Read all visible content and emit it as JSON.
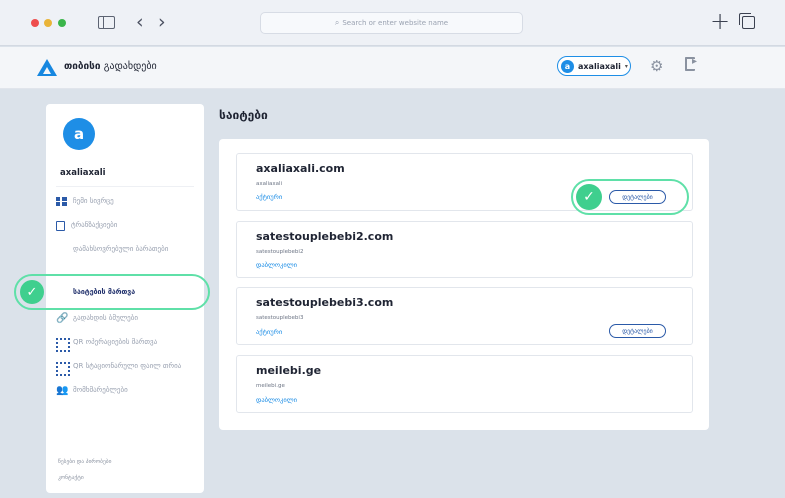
{
  "browser": {
    "address_placeholder": "Search or enter website name",
    "back_glyph": "‹",
    "forward_glyph": "›",
    "new_tab_glyph": "+"
  },
  "header": {
    "brand_bold": "თიბისი",
    "brand_rest": "გადახდები",
    "user_initial": "a",
    "username": "axaliaxali",
    "caret": "▾",
    "gear_glyph": "⚙"
  },
  "sidebar": {
    "avatar_initial": "a",
    "name": "axaliaxali",
    "items": [
      {
        "label": "ჩემი სივრცე",
        "icon": "dashboard-icon"
      },
      {
        "label": "ტრანზაქციები",
        "icon": "document-icon"
      },
      {
        "label": "დამახსოვრებული ბარათები",
        "icon": "card-icon"
      },
      {
        "label": "საიტების მართვა",
        "icon": "card-icon",
        "active": true
      },
      {
        "label": "გადახდის ბმულები",
        "icon": "link-icon"
      },
      {
        "label": "QR ოპერაციების მართვა",
        "icon": "qr-icon"
      },
      {
        "label": "QR სტაციონარული ფაილ თრია",
        "icon": "qr-icon"
      },
      {
        "label": "მომხმარებლები",
        "icon": "people-icon"
      }
    ],
    "footer": [
      "წესები და პირობები",
      "კონტაქტი"
    ]
  },
  "main": {
    "title": "საიტები",
    "details_label": "დეტალები",
    "sites": [
      {
        "domain": "axaliaxali.com",
        "sub": "axaliaxali",
        "status": "აქტიური",
        "has_details": true
      },
      {
        "domain": "satestouplebebi2.com",
        "sub": "satestouplebebi2",
        "status": "დაბლოკილი",
        "has_details": false
      },
      {
        "domain": "satestouplebebi3.com",
        "sub": "satestouplebebi3",
        "status": "აქტიური",
        "has_details": true
      },
      {
        "domain": "meilebi.ge",
        "sub": "meilebi.ge",
        "status": "დაბლოკილი",
        "has_details": false
      }
    ]
  },
  "colors": {
    "accent": "#1e8ee6",
    "highlight": "#5fe0a8",
    "check": "#3fcf8e",
    "nav_icon": "#2b5aa8"
  }
}
